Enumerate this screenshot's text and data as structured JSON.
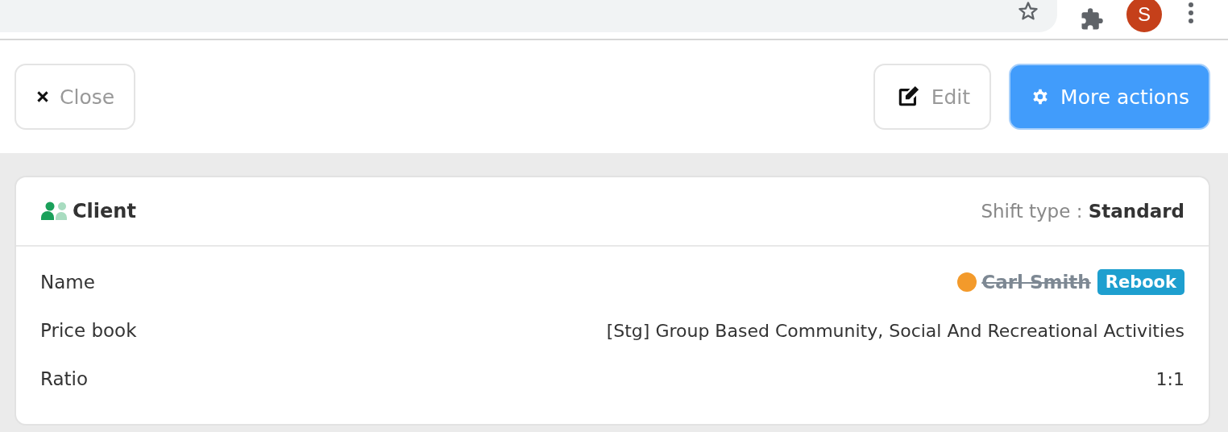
{
  "browser": {
    "avatar": "S"
  },
  "toolbar": {
    "close": "Close",
    "edit": "Edit",
    "more_actions": "More actions"
  },
  "card": {
    "title": "Client",
    "shift_type_label": "Shift type :",
    "shift_type_value": "Standard",
    "rows": [
      {
        "kind": "person",
        "label": "Name",
        "value": "Carl Smith",
        "struck": true,
        "color": "#f39a2b",
        "badge": "Rebook"
      },
      {
        "kind": "text",
        "label": "Price book",
        "value": "[Stg] Group Based Community, Social And Recreational Activities"
      },
      {
        "kind": "text",
        "label": "Ratio",
        "value": "1:1"
      }
    ]
  }
}
